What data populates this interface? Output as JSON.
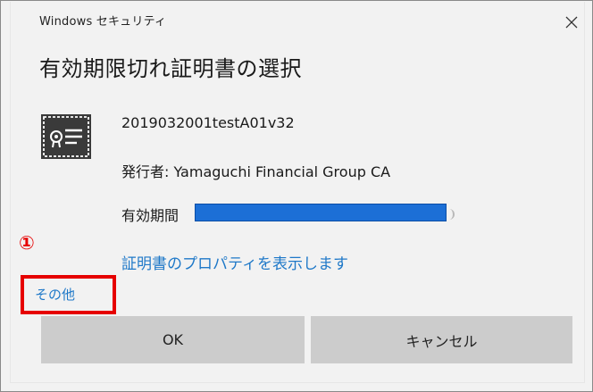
{
  "window": {
    "app_title": "Windows セキュリティ",
    "close_icon": "close-icon"
  },
  "dialog": {
    "heading": "有効期限切れ証明書の選択"
  },
  "certificate": {
    "icon": "certificate-icon",
    "name": "2019032001testA01v32",
    "issuer_text": "発行者: Yamaguchi Financial Group CA",
    "validity_label": "有効期間",
    "validity_value_redacted": true,
    "properties_link": "証明書のプロパティを表示します"
  },
  "more_link": "その他",
  "annotation": {
    "marker": "①",
    "color": "#e60000"
  },
  "buttons": {
    "ok": "OK",
    "cancel": "キャンセル"
  },
  "colors": {
    "link": "#1e78c8",
    "redaction": "#1c6fd6",
    "button_bg": "#cccccc",
    "dialog_bg": "#f2f2f2"
  }
}
